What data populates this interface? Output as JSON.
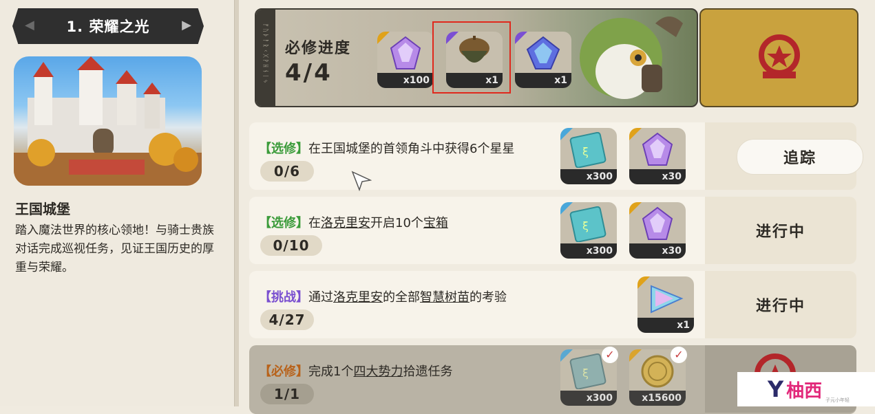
{
  "chapter": {
    "title": "1. 荣耀之光",
    "prev_icon": "chevron-left-icon",
    "next_icon": "chevron-right-icon"
  },
  "location": {
    "name": "王国城堡",
    "description": "踏入魔法世界的核心领地！与骑士贵族对话完成巡视任务，见证王国历史的厚重与荣耀。"
  },
  "required_progress": {
    "label": "必修进度",
    "count": "4/4",
    "rewards": [
      {
        "icon": "purple-crystal-icon",
        "qty": "x100"
      },
      {
        "icon": "acorn-icon",
        "qty": "x1"
      },
      {
        "icon": "blue-crystal-icon",
        "qty": "x1"
      }
    ]
  },
  "tasks": [
    {
      "tag": "【选修】",
      "desc_parts": [
        "在王国城堡的首领角斗中获得6个星星"
      ],
      "progress": "0/6",
      "rewards": [
        {
          "icon": "ticket-icon",
          "qty": "x300"
        },
        {
          "icon": "purple-crystal-icon",
          "qty": "x30"
        }
      ],
      "action": "追踪"
    },
    {
      "tag": "【选修】",
      "desc_parts": [
        "在",
        "洛克里安",
        "开启10个",
        "宝箱"
      ],
      "progress": "0/10",
      "rewards": [
        {
          "icon": "ticket-icon",
          "qty": "x300"
        },
        {
          "icon": "purple-crystal-icon",
          "qty": "x30"
        }
      ],
      "action": "进行中"
    },
    {
      "tag": "【挑战】",
      "desc_parts": [
        "通过",
        "洛克里安",
        "的全部",
        "智慧树苗",
        "的考验"
      ],
      "progress": "4/27",
      "rewards": [
        {
          "icon": "prism-icon",
          "qty": "x1"
        }
      ],
      "action": "进行中"
    },
    {
      "tag": "【必修】",
      "desc_parts": [
        "完成1个",
        "四大势力",
        "拾遗任务"
      ],
      "progress": "1/1",
      "rewards": [
        {
          "icon": "ticket-icon",
          "qty": "x300"
        },
        {
          "icon": "gold-coin-icon",
          "qty": "x15600"
        }
      ],
      "action": ""
    }
  ],
  "watermark": {
    "mark": "Y",
    "text": "柚西",
    "sub": "子元小年轻"
  },
  "colors": {
    "elective": "#3b9b3a",
    "challenge": "#7a4fd0",
    "required": "#b8621a",
    "highlight": "#e0281c"
  }
}
